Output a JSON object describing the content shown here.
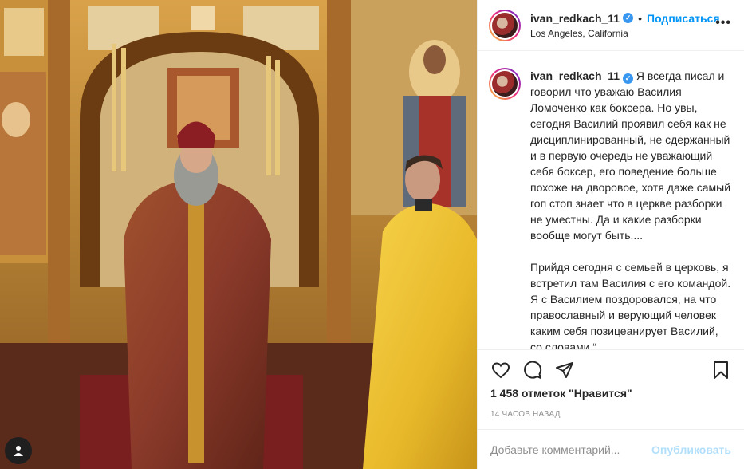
{
  "post": {
    "username": "ivan_redkach_11",
    "follow_label": "Подписаться",
    "separator": "•",
    "location": "Los Angeles, California",
    "more_label": "•••",
    "caption_username": "ivan_redkach_11",
    "caption": "Я всегда писал и говорил что уважаю Василия Ломоченко как боксера. Но увы, сегодня Василий проявил себя как не дисциплинированный, не сдержанный и в первую очередь не уважающий себя боксер, его поведение больше похоже на дворовое, хотя даже самый гоп стоп знает что в церкве разборки не уместны. Да и какие разборки вообще могут быть....\n\nПрийдя сегодня с семьей в церковь, я встретил там Василия с его командой. Я с Василием поздоровался, на что православный и верующий человек каким себя позицеанирует Василий, со словами “…….. ……………….."
  },
  "actions": {
    "like_icon": "heart-icon",
    "comment_icon": "comment-bubble-icon",
    "share_icon": "paper-plane-icon",
    "save_icon": "bookmark-icon"
  },
  "likes_text": "1 458 отметок \"Нравится\"",
  "time_text": "14 ЧАСОВ НАЗАД",
  "comment": {
    "placeholder": "Добавьте комментарий...",
    "publish_label": "Опубликовать"
  },
  "colors": {
    "accent": "#0095f6",
    "publish_disabled": "#b2dffc",
    "verified": "#3897f0"
  }
}
